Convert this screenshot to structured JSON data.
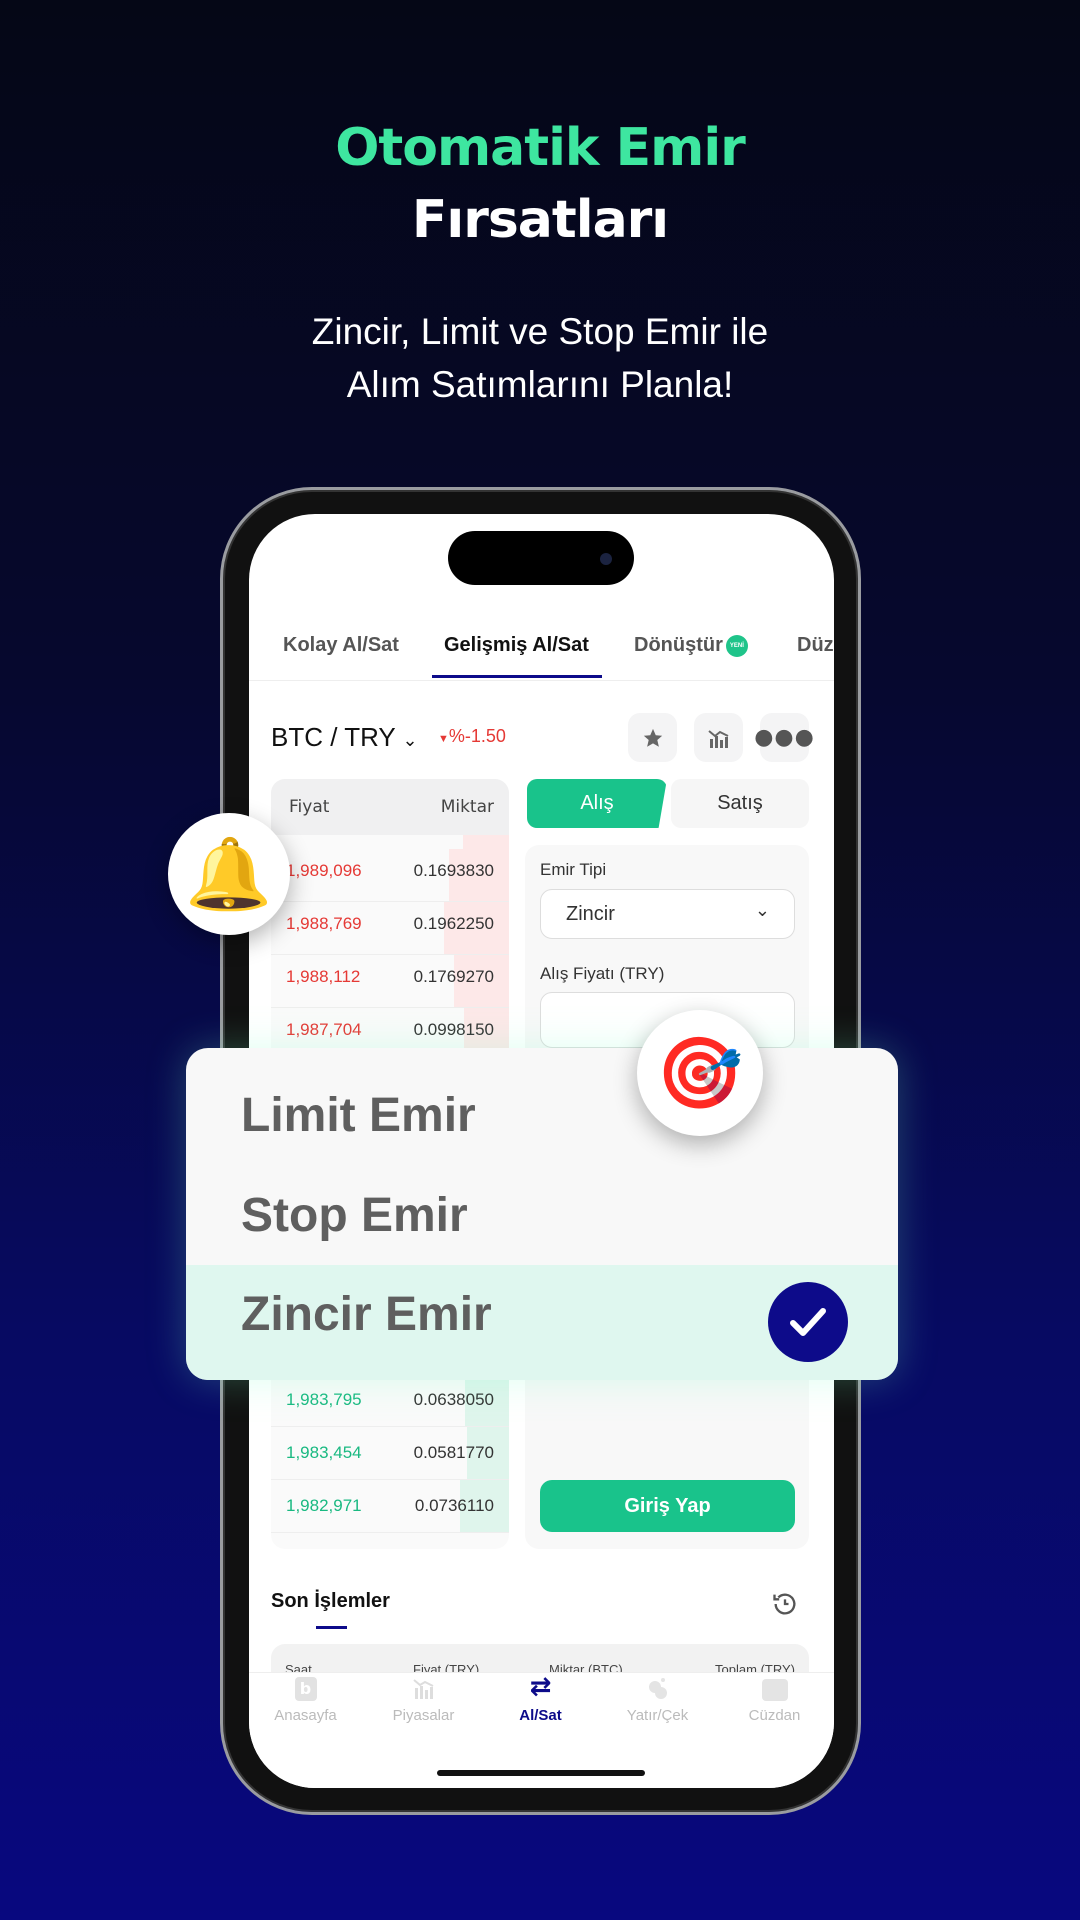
{
  "hero": {
    "title_line1": "Otomatik Emir",
    "title_line2": "Fırsatları",
    "subtitle_line1": "Zincir, Limit ve Stop Emir ile",
    "subtitle_line2": "Alım Satımlarını Planla!"
  },
  "colors": {
    "accent_green": "#3ee6a0",
    "primary_green": "#19c38b",
    "navy": "#0d0b8a",
    "sell_red": "#e53935",
    "buy_green": "#19b981"
  },
  "tabs": [
    {
      "label": "Kolay Al/Sat"
    },
    {
      "label": "Gelişmiş Al/Sat",
      "active": true
    },
    {
      "label": "Dönüştür",
      "badge": "YENİ"
    },
    {
      "label": "Düz"
    }
  ],
  "pair": {
    "name": "BTC / TRY",
    "change": "%-1.50",
    "icons": [
      "star-icon",
      "chart-icon",
      "more-icon"
    ]
  },
  "orderbook": {
    "header_price": "Fiyat",
    "header_amount": "Miktar",
    "asks": [
      {
        "price": "1,989,096",
        "amount": "0.1693830"
      },
      {
        "price": "1,988,769",
        "amount": "0.1962250"
      },
      {
        "price": "1,988,112",
        "amount": "0.1769270"
      },
      {
        "price": "1,987,704",
        "amount": "0.0998150"
      }
    ],
    "bids": [
      {
        "price": "1,983,795",
        "amount": "0.0638050"
      },
      {
        "price": "1,983,454",
        "amount": "0.0581770"
      },
      {
        "price": "1,982,971",
        "amount": "0.0736110"
      }
    ]
  },
  "form": {
    "buy_tab": "Alış",
    "sell_tab": "Satış",
    "order_type_label": "Emir Tipi",
    "order_type_value": "Zincir",
    "price_label": "Alış Fiyatı (TRY)",
    "price_value": "",
    "login_button": "Giriş Yap"
  },
  "order_menu": {
    "items": [
      {
        "label": "Limit Emir"
      },
      {
        "label": "Stop Emir"
      },
      {
        "label": "Zincir Emir",
        "selected": true
      }
    ]
  },
  "recent": {
    "title": "Son İşlemler",
    "columns": [
      "Saat",
      "Fiyat (TRY)",
      "Miktar (BTC)",
      "Toplam (TRY)"
    ]
  },
  "bottom_nav": [
    {
      "label": "Anasayfa"
    },
    {
      "label": "Piyasalar"
    },
    {
      "label": "Al/Sat",
      "active": true
    },
    {
      "label": "Yatır/Çek"
    },
    {
      "label": "Cüzdan"
    }
  ]
}
